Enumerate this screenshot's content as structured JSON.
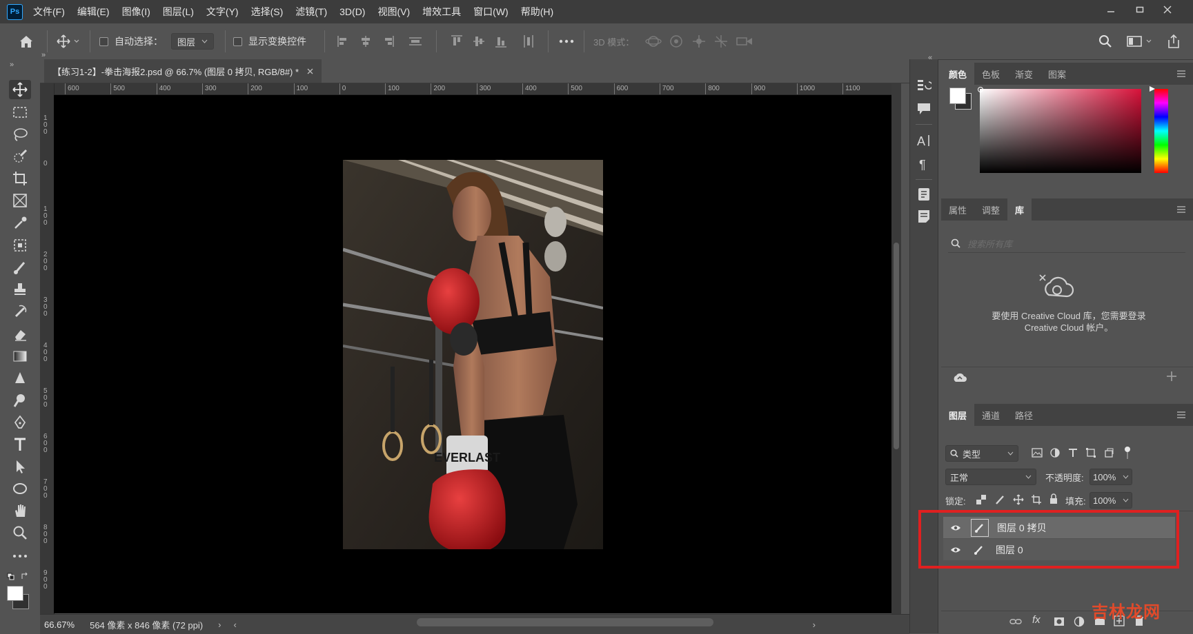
{
  "menubar": {
    "logo": "Ps",
    "items": [
      "文件(F)",
      "编辑(E)",
      "图像(I)",
      "图层(L)",
      "文字(Y)",
      "选择(S)",
      "滤镜(T)",
      "3D(D)",
      "视图(V)",
      "增效工具",
      "窗口(W)",
      "帮助(H)"
    ]
  },
  "options": {
    "auto_select_label": "自动选择：",
    "auto_select_value": "图层",
    "show_transform_label": "显示变换控件",
    "mode3d_label": "3D 模式："
  },
  "document": {
    "tab_title": "【练习1-2】-拳击海报2.psd @ 66.7% (图层 0 拷贝, RGB/8#) *",
    "ruler_top": [
      "600",
      "500",
      "400",
      "300",
      "200",
      "100",
      "0",
      "100",
      "200",
      "300",
      "400",
      "500",
      "600",
      "700",
      "800",
      "900",
      "1000",
      "1100"
    ],
    "ruler_left": [
      "1\n0\n0",
      "0",
      "1\n0\n0",
      "2\n0\n0",
      "3\n0\n0",
      "4\n0\n0",
      "5\n0\n0",
      "6\n0\n0",
      "7\n0\n0",
      "8\n0\n0",
      "9\n0\n0"
    ],
    "zoom": "66.67%",
    "doc_info": "564 像素 x 846 像素 (72 ppi)"
  },
  "color_panel": {
    "tabs": [
      "颜色",
      "色板",
      "渐变",
      "图案"
    ],
    "active_tab": "颜色"
  },
  "props_panel": {
    "tabs": [
      "属性",
      "调整",
      "库"
    ],
    "active_tab": "库",
    "search_placeholder": "搜索所有库",
    "cc_message": "要使用 Creative Cloud 库，您需要登录 Creative Cloud 帐户。"
  },
  "layers_panel": {
    "tabs": [
      "图层",
      "通道",
      "路径"
    ],
    "active_tab": "图层",
    "filter_label": "类型",
    "blend_mode": "正常",
    "opacity_label": "不透明度:",
    "opacity_value": "100%",
    "lock_label": "锁定:",
    "fill_label": "填充:",
    "fill_value": "100%",
    "layers": [
      {
        "name": "图层 0 拷贝",
        "selected": true
      },
      {
        "name": "图层 0",
        "selected": false
      }
    ]
  },
  "watermark": "吉林龙网",
  "colors": {
    "highlight_box": "#e02020",
    "accent": "#31a8ff"
  }
}
